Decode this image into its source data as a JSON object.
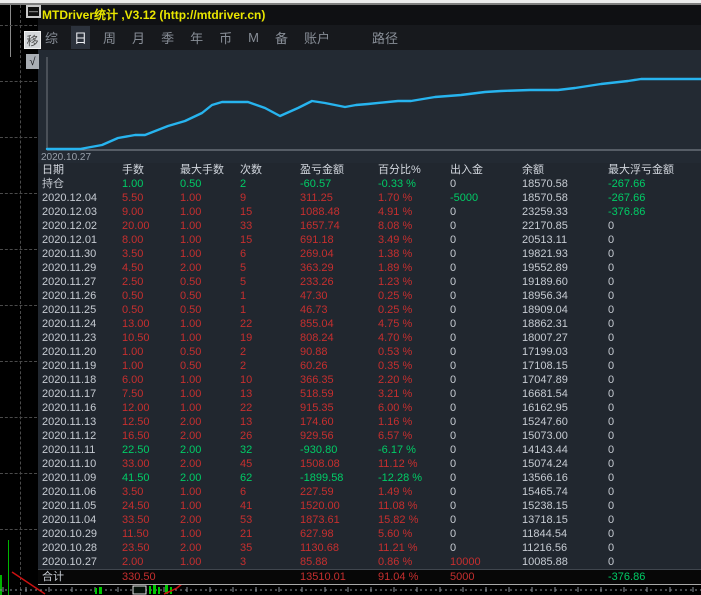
{
  "window": {
    "title": "MTDriver统计 ,V3.12 (http://mtdriver.cn)",
    "menu": {
      "items": [
        "综",
        "日",
        "周",
        "月",
        "季",
        "年",
        "币",
        "M",
        "备",
        "账户"
      ],
      "active": "日",
      "right_item": "路径"
    }
  },
  "side_controls": {
    "minimize": "—",
    "move": "移",
    "check": "√"
  },
  "chart": {
    "type": "line",
    "start_label": "2020.10.27",
    "line_color": "#27b4ef",
    "curve_points": [
      [
        9,
        99
      ],
      [
        42,
        99
      ],
      [
        64,
        95
      ],
      [
        80,
        88
      ],
      [
        97,
        85
      ],
      [
        107,
        85
      ],
      [
        130,
        76
      ],
      [
        147,
        71
      ],
      [
        164,
        63
      ],
      [
        174,
        55
      ],
      [
        184,
        52
      ],
      [
        210,
        52
      ],
      [
        227,
        58
      ],
      [
        242,
        66
      ],
      [
        260,
        58
      ],
      [
        274,
        51
      ],
      [
        287,
        53
      ],
      [
        297,
        55
      ],
      [
        307,
        57
      ],
      [
        318,
        55
      ],
      [
        330,
        54
      ],
      [
        360,
        51
      ],
      [
        373,
        51
      ],
      [
        397,
        47
      ],
      [
        423,
        45
      ],
      [
        447,
        42
      ],
      [
        463,
        41
      ],
      [
        492,
        40
      ],
      [
        520,
        40
      ],
      [
        537,
        38
      ],
      [
        563,
        34
      ],
      [
        590,
        31
      ],
      [
        603,
        29
      ],
      [
        663,
        29
      ]
    ]
  },
  "table": {
    "headers": [
      "日期",
      "手数",
      "最大手数",
      "次数",
      "盈亏金额",
      "百分比%",
      "出入金",
      "余额",
      "最大浮亏金额"
    ],
    "rows": [
      {
        "date": "持仓",
        "lots": "1.00",
        "max_lots": "0.50",
        "count": "2",
        "pnl": "-60.57",
        "pct": "-0.33 %",
        "inout": "0",
        "balance": "18570.58",
        "max_float": "-267.66"
      },
      {
        "date": "2020.12.04",
        "lots": "5.50",
        "max_lots": "1.00",
        "count": "9",
        "pnl": "311.25",
        "pct": "1.70 %",
        "inout": "-5000",
        "balance": "18570.58",
        "max_float": "-267.66"
      },
      {
        "date": "2020.12.03",
        "lots": "9.00",
        "max_lots": "1.00",
        "count": "15",
        "pnl": "1088.48",
        "pct": "4.91 %",
        "inout": "0",
        "balance": "23259.33",
        "max_float": "-376.86"
      },
      {
        "date": "2020.12.02",
        "lots": "20.00",
        "max_lots": "1.00",
        "count": "33",
        "pnl": "1657.74",
        "pct": "8.08 %",
        "inout": "0",
        "balance": "22170.85",
        "max_float": "0"
      },
      {
        "date": "2020.12.01",
        "lots": "8.00",
        "max_lots": "1.00",
        "count": "15",
        "pnl": "691.18",
        "pct": "3.49 %",
        "inout": "0",
        "balance": "20513.11",
        "max_float": "0"
      },
      {
        "date": "2020.11.30",
        "lots": "3.50",
        "max_lots": "1.00",
        "count": "6",
        "pnl": "269.04",
        "pct": "1.38 %",
        "inout": "0",
        "balance": "19821.93",
        "max_float": "0"
      },
      {
        "date": "2020.11.29",
        "lots": "4.50",
        "max_lots": "2.00",
        "count": "5",
        "pnl": "363.29",
        "pct": "1.89 %",
        "inout": "0",
        "balance": "19552.89",
        "max_float": "0"
      },
      {
        "date": "2020.11.27",
        "lots": "2.50",
        "max_lots": "0.50",
        "count": "5",
        "pnl": "233.26",
        "pct": "1.23 %",
        "inout": "0",
        "balance": "19189.60",
        "max_float": "0"
      },
      {
        "date": "2020.11.26",
        "lots": "0.50",
        "max_lots": "0.50",
        "count": "1",
        "pnl": "47.30",
        "pct": "0.25 %",
        "inout": "0",
        "balance": "18956.34",
        "max_float": "0"
      },
      {
        "date": "2020.11.25",
        "lots": "0.50",
        "max_lots": "0.50",
        "count": "1",
        "pnl": "46.73",
        "pct": "0.25 %",
        "inout": "0",
        "balance": "18909.04",
        "max_float": "0"
      },
      {
        "date": "2020.11.24",
        "lots": "13.00",
        "max_lots": "1.00",
        "count": "22",
        "pnl": "855.04",
        "pct": "4.75 %",
        "inout": "0",
        "balance": "18862.31",
        "max_float": "0"
      },
      {
        "date": "2020.11.23",
        "lots": "10.50",
        "max_lots": "1.00",
        "count": "19",
        "pnl": "808.24",
        "pct": "4.70 %",
        "inout": "0",
        "balance": "18007.27",
        "max_float": "0"
      },
      {
        "date": "2020.11.20",
        "lots": "1.00",
        "max_lots": "0.50",
        "count": "2",
        "pnl": "90.88",
        "pct": "0.53 %",
        "inout": "0",
        "balance": "17199.03",
        "max_float": "0"
      },
      {
        "date": "2020.11.19",
        "lots": "1.00",
        "max_lots": "0.50",
        "count": "2",
        "pnl": "60.26",
        "pct": "0.35 %",
        "inout": "0",
        "balance": "17108.15",
        "max_float": "0"
      },
      {
        "date": "2020.11.18",
        "lots": "6.00",
        "max_lots": "1.00",
        "count": "10",
        "pnl": "366.35",
        "pct": "2.20 %",
        "inout": "0",
        "balance": "17047.89",
        "max_float": "0"
      },
      {
        "date": "2020.11.17",
        "lots": "7.50",
        "max_lots": "1.00",
        "count": "13",
        "pnl": "518.59",
        "pct": "3.21 %",
        "inout": "0",
        "balance": "16681.54",
        "max_float": "0"
      },
      {
        "date": "2020.11.16",
        "lots": "12.00",
        "max_lots": "1.00",
        "count": "22",
        "pnl": "915.35",
        "pct": "6.00 %",
        "inout": "0",
        "balance": "16162.95",
        "max_float": "0"
      },
      {
        "date": "2020.11.13",
        "lots": "12.50",
        "max_lots": "2.00",
        "count": "13",
        "pnl": "174.60",
        "pct": "1.16 %",
        "inout": "0",
        "balance": "15247.60",
        "max_float": "0"
      },
      {
        "date": "2020.11.12",
        "lots": "16.50",
        "max_lots": "2.00",
        "count": "26",
        "pnl": "929.56",
        "pct": "6.57 %",
        "inout": "0",
        "balance": "15073.00",
        "max_float": "0"
      },
      {
        "date": "2020.11.11",
        "lots": "22.50",
        "max_lots": "2.00",
        "count": "32",
        "pnl": "-930.80",
        "pct": "-6.17 %",
        "inout": "0",
        "balance": "14143.44",
        "max_float": "0"
      },
      {
        "date": "2020.11.10",
        "lots": "33.00",
        "max_lots": "2.00",
        "count": "45",
        "pnl": "1508.08",
        "pct": "11.12 %",
        "inout": "0",
        "balance": "15074.24",
        "max_float": "0"
      },
      {
        "date": "2020.11.09",
        "lots": "41.50",
        "max_lots": "2.00",
        "count": "62",
        "pnl": "-1899.58",
        "pct": "-12.28 %",
        "inout": "0",
        "balance": "13566.16",
        "max_float": "0"
      },
      {
        "date": "2020.11.06",
        "lots": "3.50",
        "max_lots": "1.00",
        "count": "6",
        "pnl": "227.59",
        "pct": "1.49 %",
        "inout": "0",
        "balance": "15465.74",
        "max_float": "0"
      },
      {
        "date": "2020.11.05",
        "lots": "24.50",
        "max_lots": "1.00",
        "count": "41",
        "pnl": "1520.00",
        "pct": "11.08 %",
        "inout": "0",
        "balance": "15238.15",
        "max_float": "0"
      },
      {
        "date": "2020.11.04",
        "lots": "33.50",
        "max_lots": "2.00",
        "count": "53",
        "pnl": "1873.61",
        "pct": "15.82 %",
        "inout": "0",
        "balance": "13718.15",
        "max_float": "0"
      },
      {
        "date": "2020.10.29",
        "lots": "11.50",
        "max_lots": "1.00",
        "count": "21",
        "pnl": "627.98",
        "pct": "5.60 %",
        "inout": "0",
        "balance": "11844.54",
        "max_float": "0"
      },
      {
        "date": "2020.10.28",
        "lots": "23.50",
        "max_lots": "2.00",
        "count": "35",
        "pnl": "1130.68",
        "pct": "11.21 %",
        "inout": "0",
        "balance": "11216.56",
        "max_float": "0"
      },
      {
        "date": "2020.10.27",
        "lots": "2.00",
        "max_lots": "1.00",
        "count": "3",
        "pnl": "85.88",
        "pct": "0.86 %",
        "inout": "10000",
        "balance": "10085.88",
        "max_float": "0"
      }
    ],
    "total": {
      "date": "合计",
      "lots": "330.50",
      "max_lots": "",
      "count": "",
      "pnl": "13510.01",
      "pct": "91.04 %",
      "inout": "5000",
      "balance": "",
      "max_float": "-376.86"
    }
  },
  "colors": {
    "gain": "#c62f2f",
    "loss": "#00cc66",
    "neutral": "#c6cbd2",
    "title": "#e9e600",
    "curve": "#27b4ef"
  }
}
